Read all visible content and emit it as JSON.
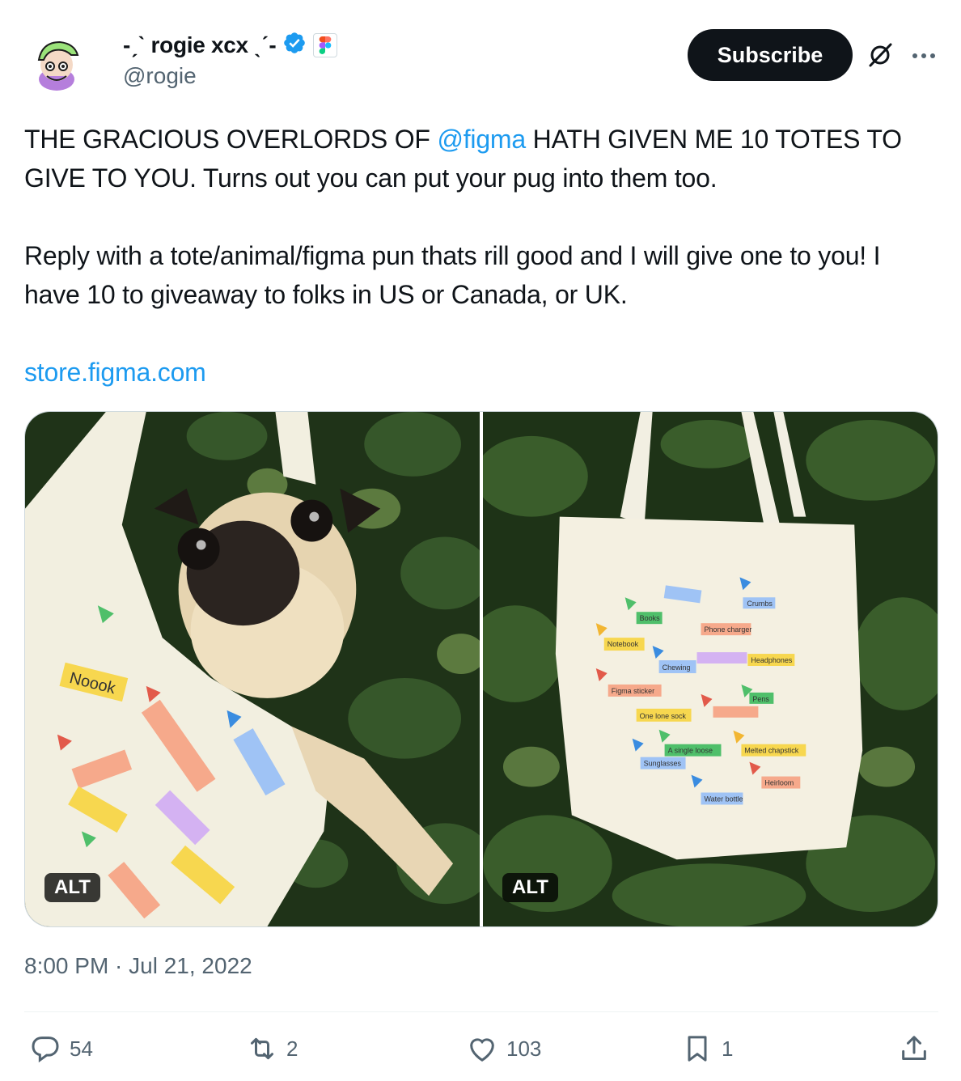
{
  "author": {
    "display_name": "-ˏˋ rogie xcx ˎˊ-",
    "handle": "@rogie",
    "verified_icon": "verified-badge-icon",
    "org_badge_icon": "figma-logo-icon"
  },
  "header": {
    "subscribe_label": "Subscribe",
    "grok_icon": "grok-icon",
    "more_icon": "more-options-icon"
  },
  "tweet": {
    "p1_pre": "THE GRACIOUS OVERLORDS OF ",
    "p1_mention": "@figma",
    "p1_post": " HATH GIVEN ME 10 TOTES TO GIVE TO YOU. Turns out you can put your pug into them too.",
    "p2": "Reply with a tote/animal/figma pun thats rill good and I will give one to you! I have 10 to giveaway to folks in US or Canada, or UK.",
    "link": "store.figma.com"
  },
  "media": {
    "images": [
      {
        "alt_label": "ALT"
      },
      {
        "alt_label": "ALT"
      }
    ]
  },
  "timestamp": "8:00 PM · Jul 21, 2022",
  "actions": {
    "replies": "54",
    "reposts": "2",
    "likes": "103",
    "bookmarks": "1"
  },
  "colors": {
    "accent": "#1d9bf0",
    "text": "#0f1419",
    "muted": "#536471"
  }
}
